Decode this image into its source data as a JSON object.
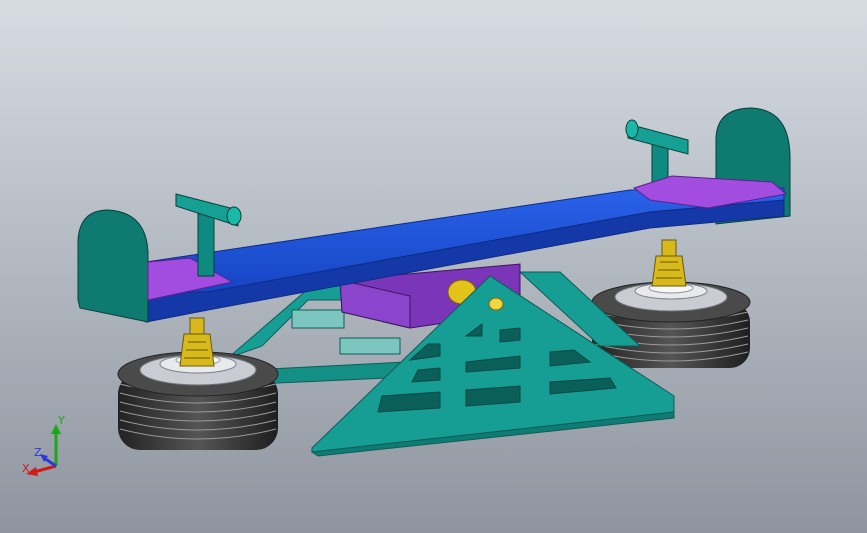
{
  "viewport": {
    "background_top": "#d7dce3",
    "background_bottom": "#8e959e"
  },
  "model": {
    "colors": {
      "beam": "#1a4fd6",
      "beam_dark": "#1438a8",
      "seat_pad": "#a24de0",
      "handle": "#0f8a80",
      "end_board": "#0f7a70",
      "frame": "#169e94",
      "pivot_housing": "#7a35b8",
      "pivot_pin": "#e3c21a",
      "spring": "#d7b91e",
      "tire": "#3a3a3a",
      "hub": "#c9cdd3"
    }
  },
  "triad": {
    "x_label": "X",
    "y_label": "Y",
    "z_label": "Z",
    "x_color": "#d11a1a",
    "y_color": "#18a818",
    "z_color": "#2a3ad8"
  }
}
